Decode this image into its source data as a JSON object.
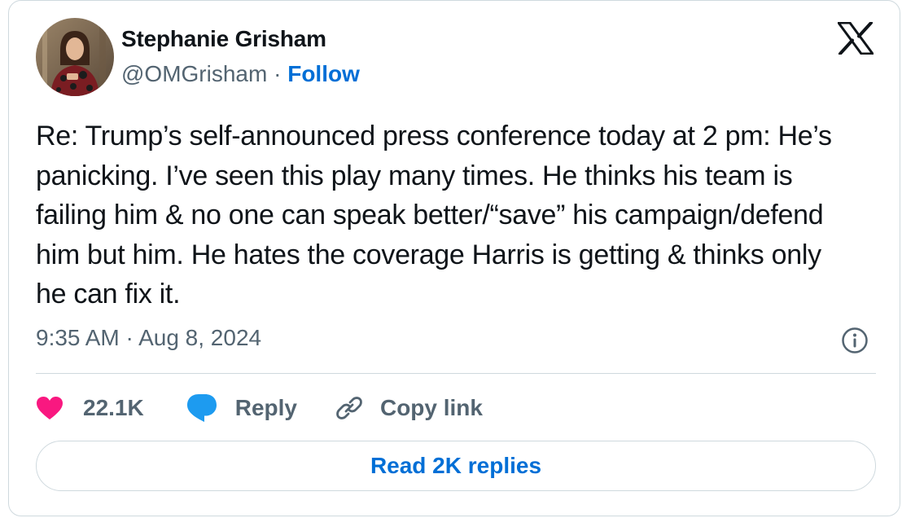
{
  "author": {
    "display_name": "Stephanie Grisham",
    "handle": "@OMGrisham",
    "separator": "·",
    "follow_label": "Follow"
  },
  "tweet": {
    "text": "Re: Trump’s self-announced press conference today at 2 pm: He’s panicking. I’ve seen this play many times. He thinks his team is failing him & no one can speak better/“save” his campaign/defend him but him. He hates the coverage Harris is getting & thinks only he can fix it.",
    "timestamp": "9:35 AM · Aug 8, 2024"
  },
  "actions": {
    "like_count": "22.1K",
    "reply_label": "Reply",
    "copy_link_label": "Copy link"
  },
  "footer": {
    "read_replies_label": "Read 2K replies"
  },
  "icons": {
    "brand": "x-logo-icon",
    "info": "info-icon",
    "like": "heart-icon",
    "reply": "speech-bubble-icon",
    "copy": "link-icon"
  },
  "colors": {
    "text": "#0f1419",
    "secondary": "#536471",
    "accent_blue": "#006fd6",
    "like_pink": "#f91880",
    "reply_blue": "#1d9bf0",
    "border": "#cfd9de"
  }
}
